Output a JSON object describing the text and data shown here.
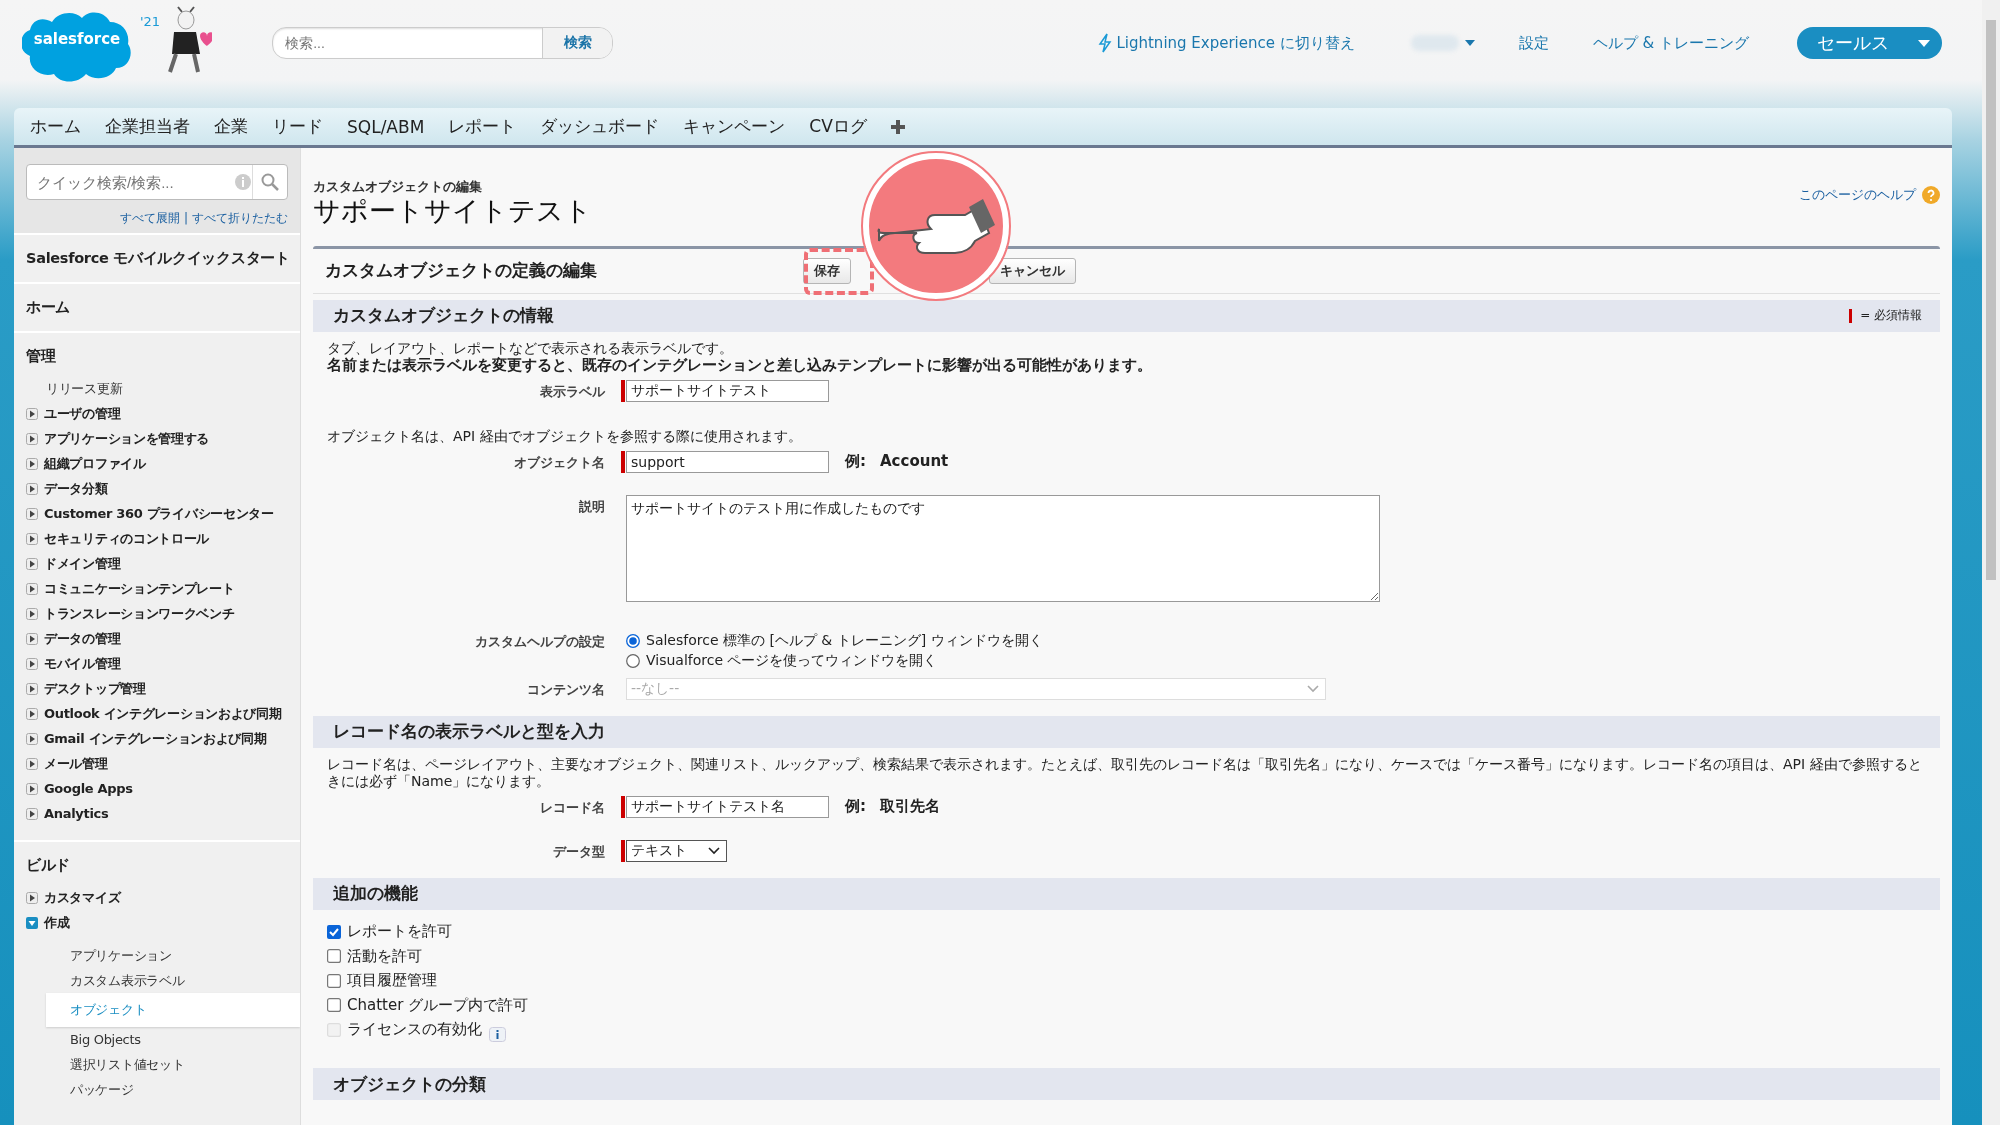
{
  "header": {
    "logo": "salesforce",
    "release_badge": "'21",
    "search": {
      "placeholder": "検索...",
      "button": "検索"
    },
    "links": [
      {
        "kind": "lightning",
        "label": "Lightning Experience に切り替え"
      },
      {
        "kind": "user_menu"
      },
      {
        "kind": "plain",
        "label": "設定"
      },
      {
        "kind": "plain",
        "label": "ヘルプ & トレーニング"
      }
    ],
    "app_menu": "セールス"
  },
  "tabs": [
    {
      "label": "ホーム",
      "selected": false
    },
    {
      "label": "企業担当者",
      "selected": false
    },
    {
      "label": "企業",
      "selected": false
    },
    {
      "label": "リード",
      "selected": false
    },
    {
      "label": "SQL/ABM",
      "selected": false
    },
    {
      "label": "レポート",
      "selected": false
    },
    {
      "label": "ダッシュボード",
      "selected": false
    },
    {
      "label": "キャンペーン",
      "selected": false
    },
    {
      "label": "CVログ",
      "selected": false
    }
  ],
  "sidebar": {
    "search": {
      "placeholder": "クイック検索/検索..."
    },
    "expand_all": "すべて展開",
    "separator": "|",
    "collapse_all": "すべて折りたたむ",
    "sections": [
      {
        "title": "Salesforce モバイルクイックスタート"
      },
      {
        "title": "ホーム"
      },
      {
        "title": "管理",
        "items": [
          {
            "label": "リリース更新"
          },
          {
            "label": "ユーザの管理",
            "expanded": false
          },
          {
            "label": "アプリケーションを管理する",
            "expanded": false
          },
          {
            "label": "組織プロファイル",
            "expanded": false
          },
          {
            "label": "データ分類",
            "expanded": false
          },
          {
            "label": "Customer 360 プライバシーセンター",
            "expanded": false
          },
          {
            "label": "セキュリティのコントロール",
            "expanded": false
          },
          {
            "label": "ドメイン管理",
            "expanded": false
          },
          {
            "label": "コミュニケーションテンプレート",
            "expanded": false
          },
          {
            "label": "トランスレーションワークベンチ",
            "expanded": false
          },
          {
            "label": "データの管理",
            "expanded": false
          },
          {
            "label": "モバイル管理",
            "expanded": false
          },
          {
            "label": "デスクトップ管理",
            "expanded": false
          },
          {
            "label": "Outlook インテグレーションおよび同期",
            "expanded": false
          },
          {
            "label": "Gmail インテグレーションおよび同期",
            "expanded": false
          },
          {
            "label": "メール管理",
            "expanded": false
          },
          {
            "label": "Google Apps",
            "expanded": false
          },
          {
            "label": "Analytics",
            "expanded": false
          }
        ]
      },
      {
        "title": "ビルド",
        "items": [
          {
            "label": "カスタマイズ",
            "expanded": false
          },
          {
            "label": "作成",
            "expanded": true,
            "children": [
              {
                "label": "アプリケーション",
                "selected": false
              },
              {
                "label": "カスタム表示ラベル",
                "selected": false
              },
              {
                "label": "オブジェクト",
                "selected": true
              },
              {
                "label": "Big Objects",
                "selected": false
              },
              {
                "label": "選択リスト値セット",
                "selected": false
              },
              {
                "label": "パッケージ",
                "selected": false
              }
            ]
          }
        ]
      }
    ]
  },
  "page": {
    "breadcrumb": "カスタムオブジェクトの編集",
    "title": "サポートサイトテスト",
    "help_link": "このページのヘルプ"
  },
  "form": {
    "title": "カスタムオブジェクトの定義の編集",
    "buttons": [
      "保存",
      "キャンセル"
    ],
    "required_legend": "= 必須情報",
    "sections": [
      {
        "title": "カスタムオブジェクトの情報",
        "rows": [
          {
            "kind": "note",
            "text": "タブ、レイアウト、レポートなどで表示される表示ラベルです。"
          },
          {
            "kind": "note",
            "text": "名前または表示ラベルを変更すると、既存のインテグレーションと差し込みテンプレートに影響が出る可能性があります。",
            "bold": true
          },
          {
            "kind": "field",
            "label": "表示ラベル",
            "value": "サポートサイトテスト",
            "required": true
          },
          {
            "kind": "note",
            "text": "オブジェクト名は、API 経由でオブジェクトを参照する際に使用されます。"
          },
          {
            "kind": "field",
            "label": "オブジェクト名",
            "value": "support",
            "required": true,
            "example_label": "例:",
            "example": "Account"
          },
          {
            "kind": "textarea",
            "label": "説明",
            "value": "サポートサイトのテスト用に作成したものです",
            "required": false
          },
          {
            "kind": "radios",
            "label": "カスタムヘルプの設定",
            "options": [
              {
                "label": "Salesforce 標準の [ヘルプ & トレーニング] ウィンドウを開く",
                "selected": true
              },
              {
                "label": "Visualforce ページを使ってウィンドウを開く",
                "selected": false
              }
            ]
          },
          {
            "kind": "select",
            "label": "コンテンツ名",
            "value": "--なし--",
            "required": false,
            "disabled": true
          }
        ]
      },
      {
        "title": "レコード名の表示ラベルと型を入力",
        "rows": [
          {
            "kind": "note",
            "text": "レコード名は、ページレイアウト、主要なオブジェクト、関連リスト、ルックアップ、検索結果で表示されます。たとえば、取引先のレコード名は「取引先名」になり、ケースでは「ケース番号」になります。レコード名の項目は、API 経由で参照するときには必ず「Name」になります。"
          },
          {
            "kind": "field",
            "label": "レコード名",
            "value": "サポートサイトテスト名",
            "required": true,
            "example_label": "例:",
            "example": "取引先名"
          },
          {
            "kind": "select",
            "label": "データ型",
            "value": "テキスト",
            "required": true,
            "disabled": false
          }
        ]
      },
      {
        "title": "追加の機能",
        "rows": [
          {
            "kind": "checkbox",
            "label": "レポートを許可",
            "checked": true,
            "disabled": false
          },
          {
            "kind": "checkbox",
            "label": "活動を許可",
            "checked": false,
            "disabled": false
          },
          {
            "kind": "checkbox",
            "label": "項目履歴管理",
            "checked": false,
            "disabled": false
          },
          {
            "kind": "checkbox",
            "label": "Chatter グループ内で許可",
            "checked": false,
            "disabled": false
          },
          {
            "kind": "checkbox",
            "label": "ライセンスの有効化",
            "checked": false,
            "disabled": true,
            "info": true
          }
        ]
      },
      {
        "title": "オブジェクトの分類"
      }
    ]
  },
  "annotation": {
    "kind": "pointing_hand"
  }
}
